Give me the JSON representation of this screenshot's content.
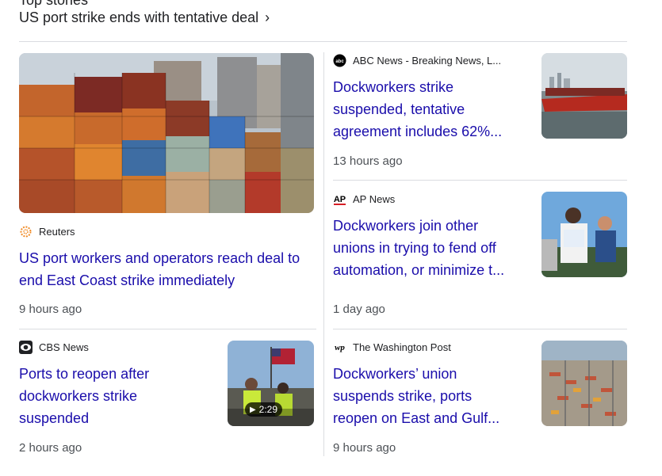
{
  "header": {
    "clipped_text": "Top stories",
    "title": "US port strike ends with tentative deal",
    "chevron": "›"
  },
  "featured": {
    "source": "Reuters",
    "title": "US port workers and operators reach deal to end East Coast strike immediately",
    "time": "9 hours ago",
    "logo_icon": "reuters-logo-icon",
    "image_icon": "shipping-containers-image"
  },
  "right_stories": [
    {
      "source": "ABC News - Breaking News, L...",
      "title_lines": [
        "Dockworkers strike",
        "suspended, tentative",
        "agreement includes 62%..."
      ],
      "time": "13 hours ago",
      "logo_text": "abc",
      "image_icon": "container-ship-image"
    },
    {
      "source": "AP News",
      "title_lines": [
        "Dockworkers join other",
        "unions in trying to fend off",
        "automation, or minimize t..."
      ],
      "time": "1 day ago",
      "logo_text": "AP",
      "image_icon": "protest-rally-image"
    },
    {
      "source": "The Washington Post",
      "title_lines": [
        "Dockworkers’ union",
        "suspends strike, ports",
        "reopen on East and Gulf..."
      ],
      "time": "9 hours ago",
      "logo_text": "wp",
      "image_icon": "port-aerial-image"
    }
  ],
  "left_bottom_story": {
    "source": "CBS News",
    "title_lines": [
      "Ports to reopen after",
      "dockworkers strike",
      "suspended"
    ],
    "time": "2 hours ago",
    "video_duration": "2:29",
    "image_icon": "dockworkers-video-image"
  },
  "colors": {
    "link": "#1a0dab",
    "divider": "#dadce0",
    "meta": "#4d5156",
    "ap_red": "#d61f26"
  }
}
